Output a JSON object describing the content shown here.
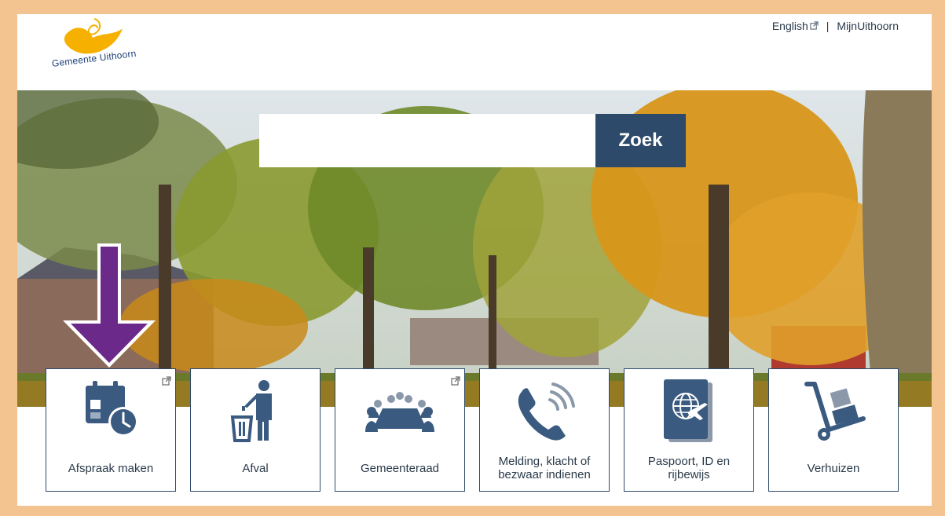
{
  "header": {
    "logo_text": "Gemeente Uithoorn",
    "links": [
      {
        "label": "English",
        "external": true
      },
      {
        "label": "MijnUithoorn",
        "external": false
      }
    ],
    "separator": "|"
  },
  "search": {
    "placeholder": "",
    "value": "",
    "button_label": "Zoek"
  },
  "colors": {
    "accent": "#2e4a6b",
    "frame": "#f3c48f",
    "arrow": "#6b2a8a",
    "icon": "#3a5a80"
  },
  "tiles": [
    {
      "label": "Afspraak maken",
      "icon": "calendar-clock-icon",
      "external": true
    },
    {
      "label": "Afval",
      "icon": "trash-person-icon",
      "external": false
    },
    {
      "label": "Gemeenteraad",
      "icon": "meeting-table-icon",
      "external": true
    },
    {
      "label": "Melding, klacht of bezwaar indienen",
      "icon": "phone-icon",
      "external": false
    },
    {
      "label": "Paspoort, ID en rijbewijs",
      "icon": "passport-icon",
      "external": false
    },
    {
      "label": "Verhuizen",
      "icon": "hand-truck-icon",
      "external": false
    }
  ]
}
